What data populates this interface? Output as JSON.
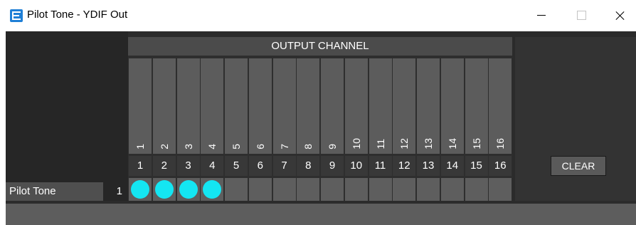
{
  "window": {
    "title": "Pilot Tone - YDIF Out",
    "icon": "app-logo-icon"
  },
  "matrix": {
    "header": "OUTPUT CHANNEL",
    "active_color": "#14e6f2",
    "channels": [
      {
        "name": "1",
        "number": "1",
        "on": true
      },
      {
        "name": "2",
        "number": "2",
        "on": true
      },
      {
        "name": "3",
        "number": "3",
        "on": true
      },
      {
        "name": "4",
        "number": "4",
        "on": true
      },
      {
        "name": "5",
        "number": "5",
        "on": false
      },
      {
        "name": "6",
        "number": "6",
        "on": false
      },
      {
        "name": "7",
        "number": "7",
        "on": false
      },
      {
        "name": "8",
        "number": "8",
        "on": false
      },
      {
        "name": "9",
        "number": "9",
        "on": false
      },
      {
        "name": "10",
        "number": "10",
        "on": false
      },
      {
        "name": "11",
        "number": "11",
        "on": false
      },
      {
        "name": "12",
        "number": "12",
        "on": false
      },
      {
        "name": "13",
        "number": "13",
        "on": false
      },
      {
        "name": "14",
        "number": "14",
        "on": false
      },
      {
        "name": "15",
        "number": "15",
        "on": false
      },
      {
        "name": "16",
        "number": "16",
        "on": false
      }
    ],
    "row": {
      "label": "Pilot Tone",
      "index": "1"
    }
  },
  "actions": {
    "clear_label": "CLEAR"
  }
}
